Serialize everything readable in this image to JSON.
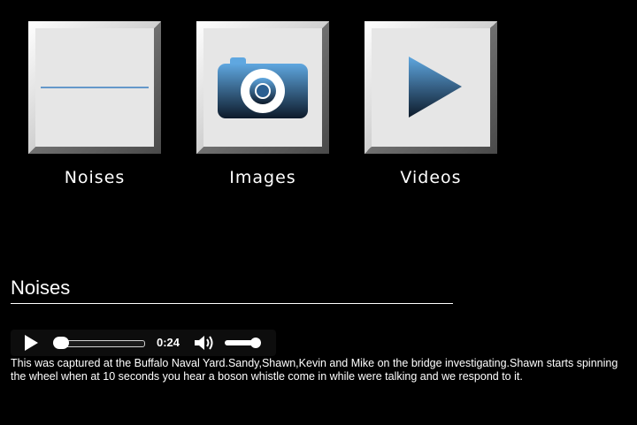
{
  "tiles": [
    {
      "label": "Noises",
      "icon": "waveform-icon"
    },
    {
      "label": "Images",
      "icon": "camera-icon"
    },
    {
      "label": "Videos",
      "icon": "play-icon"
    }
  ],
  "section": {
    "title": "Noises"
  },
  "player": {
    "time": "0:24",
    "progress": 0.0,
    "volume": 0.85
  },
  "description": "This was captured at the Buffalo Naval Yard.Sandy,Shawn,Kevin and Mike on the bridge investigating.Shawn starts spinning the wheel when at 10 seconds you hear a boson whistle come in while were talking and we respond to it.",
  "colors": {
    "background": "#000000",
    "tile_face": "#e6e6e6",
    "icon_blue": "#3a7fc0",
    "text": "#ffffff"
  }
}
